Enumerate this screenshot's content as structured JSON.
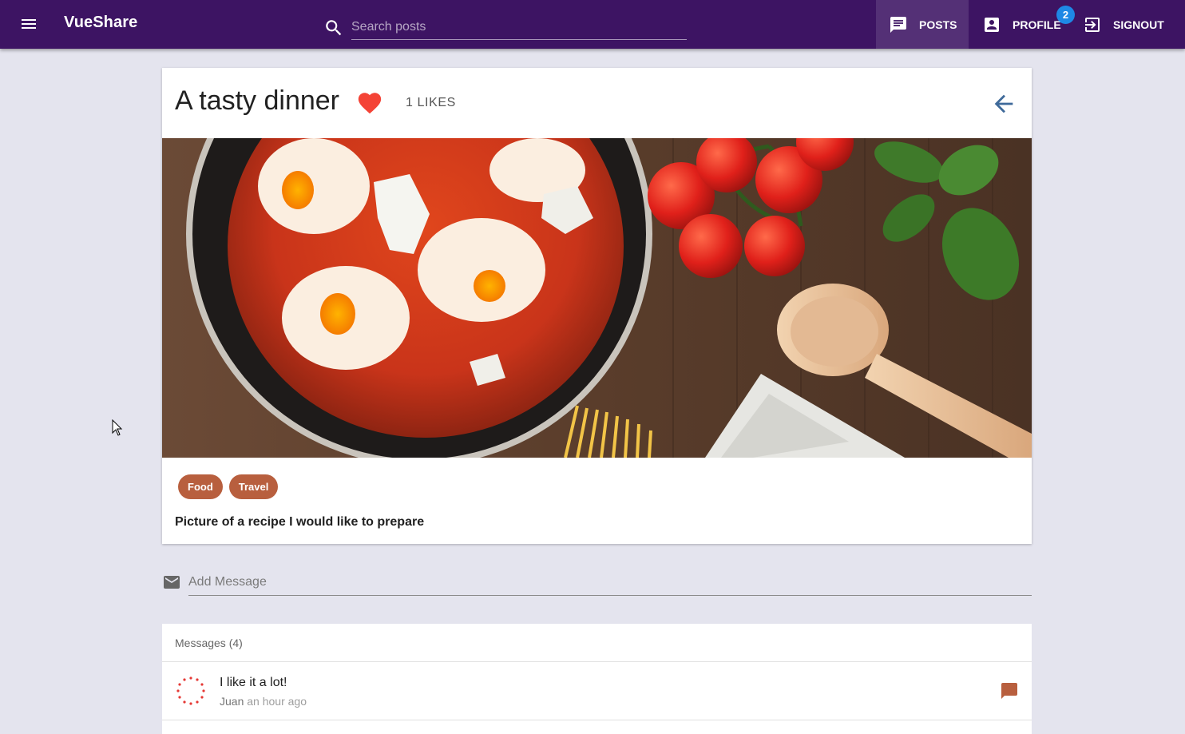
{
  "app": {
    "title": "VueShare",
    "search_placeholder": "Search posts"
  },
  "nav": {
    "posts_label": "POSTS",
    "profile_label": "PROFILE",
    "profile_badge": "2",
    "signout_label": "SIGNOUT"
  },
  "post": {
    "title": "A tasty dinner",
    "likes": "1 LIKES",
    "liked": true,
    "tags": [
      "Food",
      "Travel"
    ],
    "description": "Picture of a recipe I would like to prepare"
  },
  "message_input": {
    "placeholder": "Add Message"
  },
  "messages": {
    "header": "Messages (4)",
    "items": [
      {
        "text": "I like it a lot!",
        "author": "Juan",
        "time": "an hour ago"
      }
    ]
  },
  "colors": {
    "toolbar": "#3d1463",
    "accent": "#b85f3e",
    "heart": "#f44336",
    "badge": "#1e88e5",
    "back_arrow": "#3f6a9a"
  },
  "icons": {
    "menu": "menu-icon",
    "search": "search-icon",
    "posts": "chat-icon",
    "profile": "account-box-icon",
    "signout": "exit-to-app-icon",
    "like": "heart-icon",
    "back": "arrow-left-icon",
    "message_input": "mail-icon",
    "message_action": "comment-icon"
  }
}
